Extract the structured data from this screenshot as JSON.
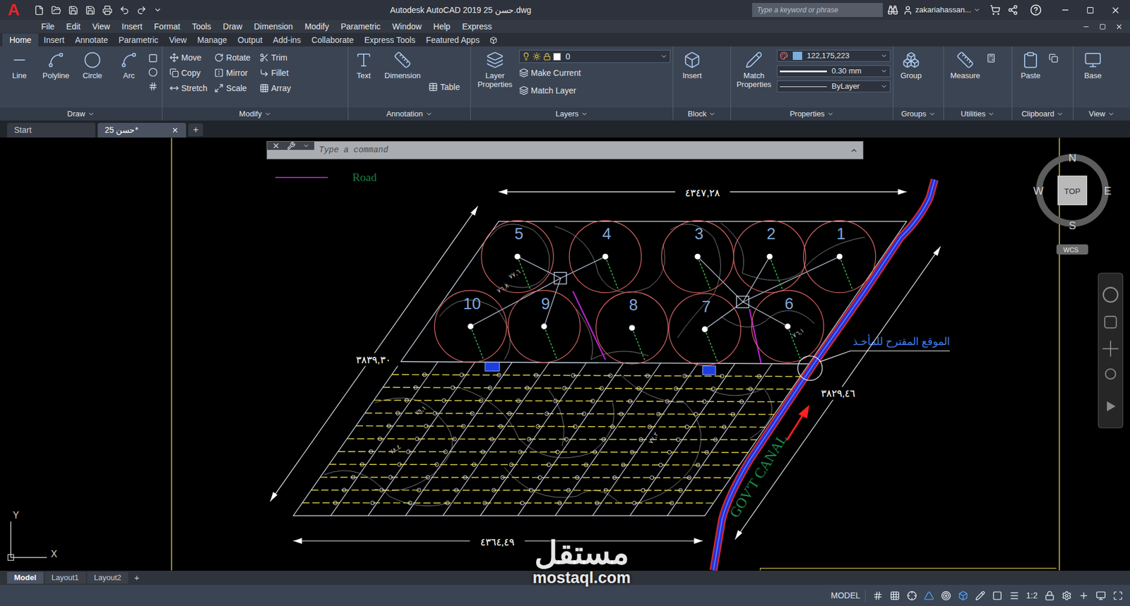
{
  "window": {
    "logo": "A",
    "title": "Autodesk AutoCAD 2019  حسن 25.dwg",
    "search_placeholder": "Type a keyword or phrase",
    "user": "zakariahassan..."
  },
  "menu": [
    "File",
    "Edit",
    "View",
    "Insert",
    "Format",
    "Tools",
    "Draw",
    "Dimension",
    "Modify",
    "Parametric",
    "Window",
    "Help",
    "Express"
  ],
  "ribbon_tabs": [
    {
      "label": "Home",
      "selected": true
    },
    {
      "label": "Insert",
      "selected": false
    },
    {
      "label": "Annotate",
      "selected": false
    },
    {
      "label": "Parametric",
      "selected": false
    },
    {
      "label": "View",
      "selected": false
    },
    {
      "label": "Manage",
      "selected": false
    },
    {
      "label": "Output",
      "selected": false
    },
    {
      "label": "Add-ins",
      "selected": false
    },
    {
      "label": "Collaborate",
      "selected": false
    },
    {
      "label": "Express Tools",
      "selected": false
    },
    {
      "label": "Featured Apps",
      "selected": false
    }
  ],
  "ribbon": {
    "draw": {
      "title": "Draw",
      "large": [
        "Line",
        "Polyline",
        "Circle",
        "Arc"
      ]
    },
    "modify": {
      "title": "Modify",
      "small": [
        "Move",
        "Rotate",
        "Trim",
        "Copy",
        "Mirror",
        "Fillet",
        "Stretch",
        "Scale",
        "Array"
      ]
    },
    "annotation": {
      "title": "Annotation",
      "large": [
        "Text",
        "Dimension"
      ],
      "small": [
        "Table"
      ]
    },
    "layers": {
      "title": "Layers",
      "large": [
        "Layer Properties"
      ],
      "layer": "0",
      "small": [
        "Make Current",
        "Match Layer"
      ]
    },
    "block": {
      "title": "Block",
      "large": [
        "Insert"
      ]
    },
    "properties": {
      "title": "Properties",
      "large": [
        "Match Properties"
      ],
      "color": "122,175,223",
      "lineweight": "0.30 mm",
      "linetype": "ByLayer"
    },
    "groups": {
      "title": "Groups",
      "large": [
        "Group"
      ]
    },
    "utilities": {
      "title": "Utilities",
      "large": [
        "Measure"
      ]
    },
    "clipboard": {
      "title": "Clipboard",
      "large": [
        "Paste"
      ]
    },
    "view": {
      "title": "View",
      "large": [
        "Base"
      ]
    }
  },
  "file_tabs": [
    {
      "label": "Start",
      "selected": false
    },
    {
      "label": "حسن 25*",
      "selected": true
    }
  ],
  "file_tab_add": "+",
  "command_line": {
    "placeholder": "Type a command"
  },
  "drawing": {
    "legend": [
      "GOV'T CANAL",
      "Road"
    ],
    "dimensions": [
      "٤٣٤٧,٢٨",
      "٣٨٣٩,٣٠",
      "٣٨٢٩,٤٦",
      "٤٣٦٤,٤٩"
    ],
    "pivots": [
      "5",
      "4",
      "3",
      "2",
      "1",
      "10",
      "9",
      "8",
      "7",
      "6"
    ],
    "intake_label": "الموقع المقترح للمأخـذ",
    "canal_label": "GOV'T CANAL",
    "contour_labels": [
      "٧٧,٦",
      "٧٦,٨",
      "٧٦,١",
      "٧٩,١",
      "٧٨,٤",
      "٧٧,٢"
    ]
  },
  "viewcube": {
    "top": "TOP",
    "north": "N",
    "south": "S",
    "east": "E",
    "west": "W",
    "wcs": "WCS"
  },
  "ucs": {
    "x": "X",
    "y": "Y"
  },
  "layout_tabs": [
    {
      "label": "Model",
      "selected": true
    },
    {
      "label": "Layout1",
      "selected": false
    },
    {
      "label": "Layout2",
      "selected": false
    }
  ],
  "layout_tab_add": "+",
  "status_bar": {
    "model": "MODEL",
    "scale": "1:2"
  },
  "watermark": {
    "arabic": "مستقل",
    "latin": "mostaql.com"
  }
}
